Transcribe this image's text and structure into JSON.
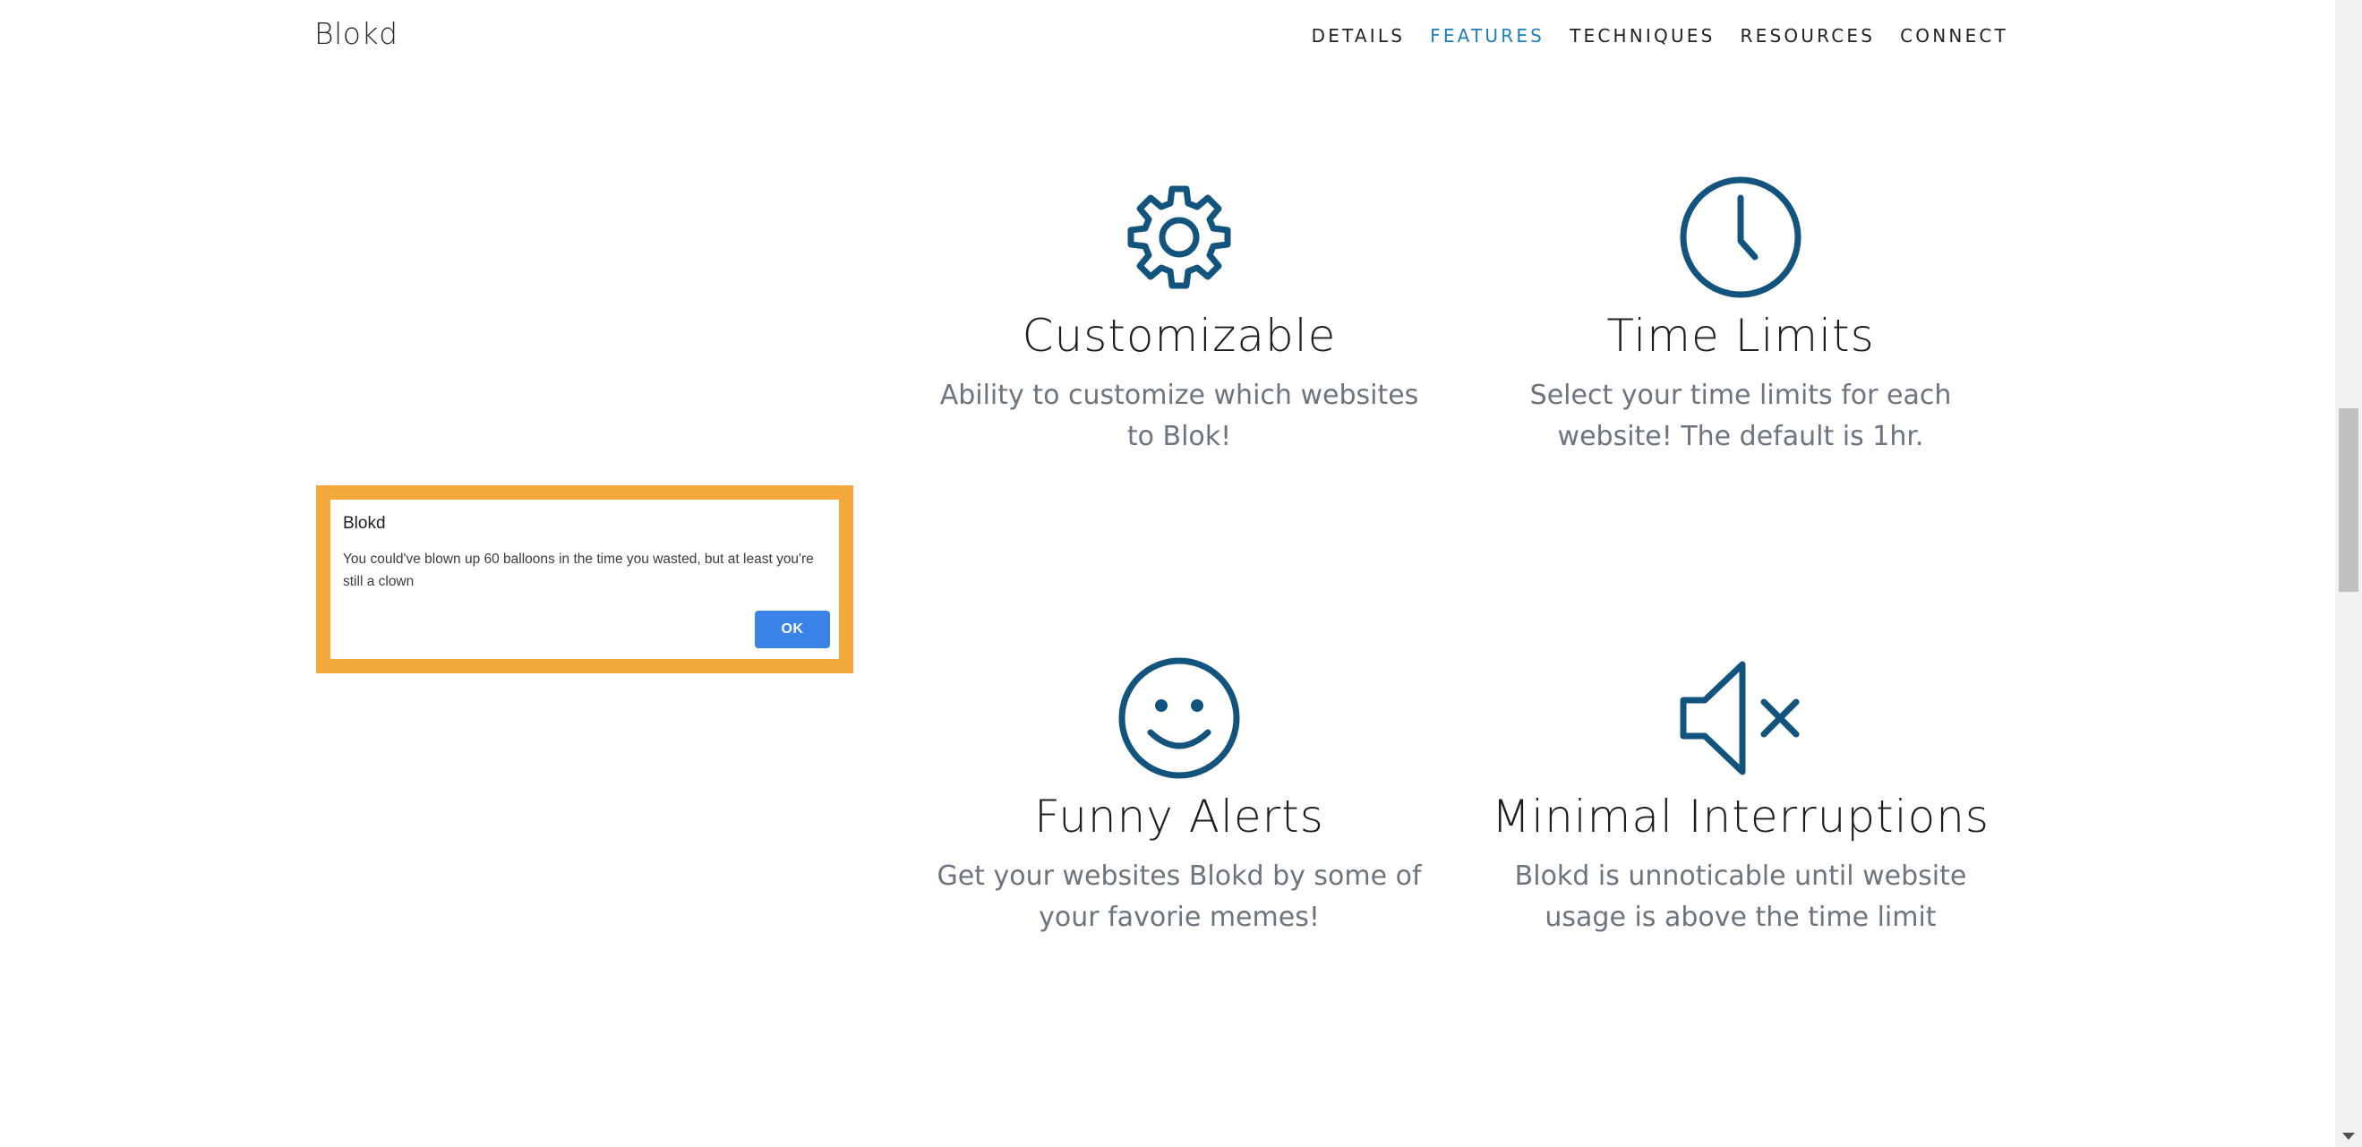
{
  "navbar": {
    "brand": "Blokd",
    "links": [
      {
        "label": "DETAILS",
        "active": false
      },
      {
        "label": "FEATURES",
        "active": true
      },
      {
        "label": "TECHNIQUES",
        "active": false
      },
      {
        "label": "RESOURCES",
        "active": false
      },
      {
        "label": "CONNECT",
        "active": false
      }
    ]
  },
  "features": [
    {
      "icon": "gear-icon",
      "title": "Customizable",
      "text": "Ability to customize which websites to Blok!"
    },
    {
      "icon": "clock-icon",
      "title": "Time Limits",
      "text": "Select your time limits for each website! The default is 1hr."
    },
    {
      "icon": "smiley-icon",
      "title": "Funny Alerts",
      "text": "Get your websites Blokd by some of your favorie memes!"
    },
    {
      "icon": "mute-icon",
      "title": "Minimal Interruptions",
      "text": "Blokd is unnoticable until website usage is above the time limit"
    }
  ],
  "alert": {
    "title": "Blokd",
    "message": "You could've blown up 60 balloons in the time you wasted, but at least you're still a clown",
    "ok_label": "OK"
  },
  "colors": {
    "accent": "#1d7fb8",
    "icon": "#12547d",
    "highlight_frame": "#f2a83a",
    "ok_button": "#3b82e6"
  }
}
